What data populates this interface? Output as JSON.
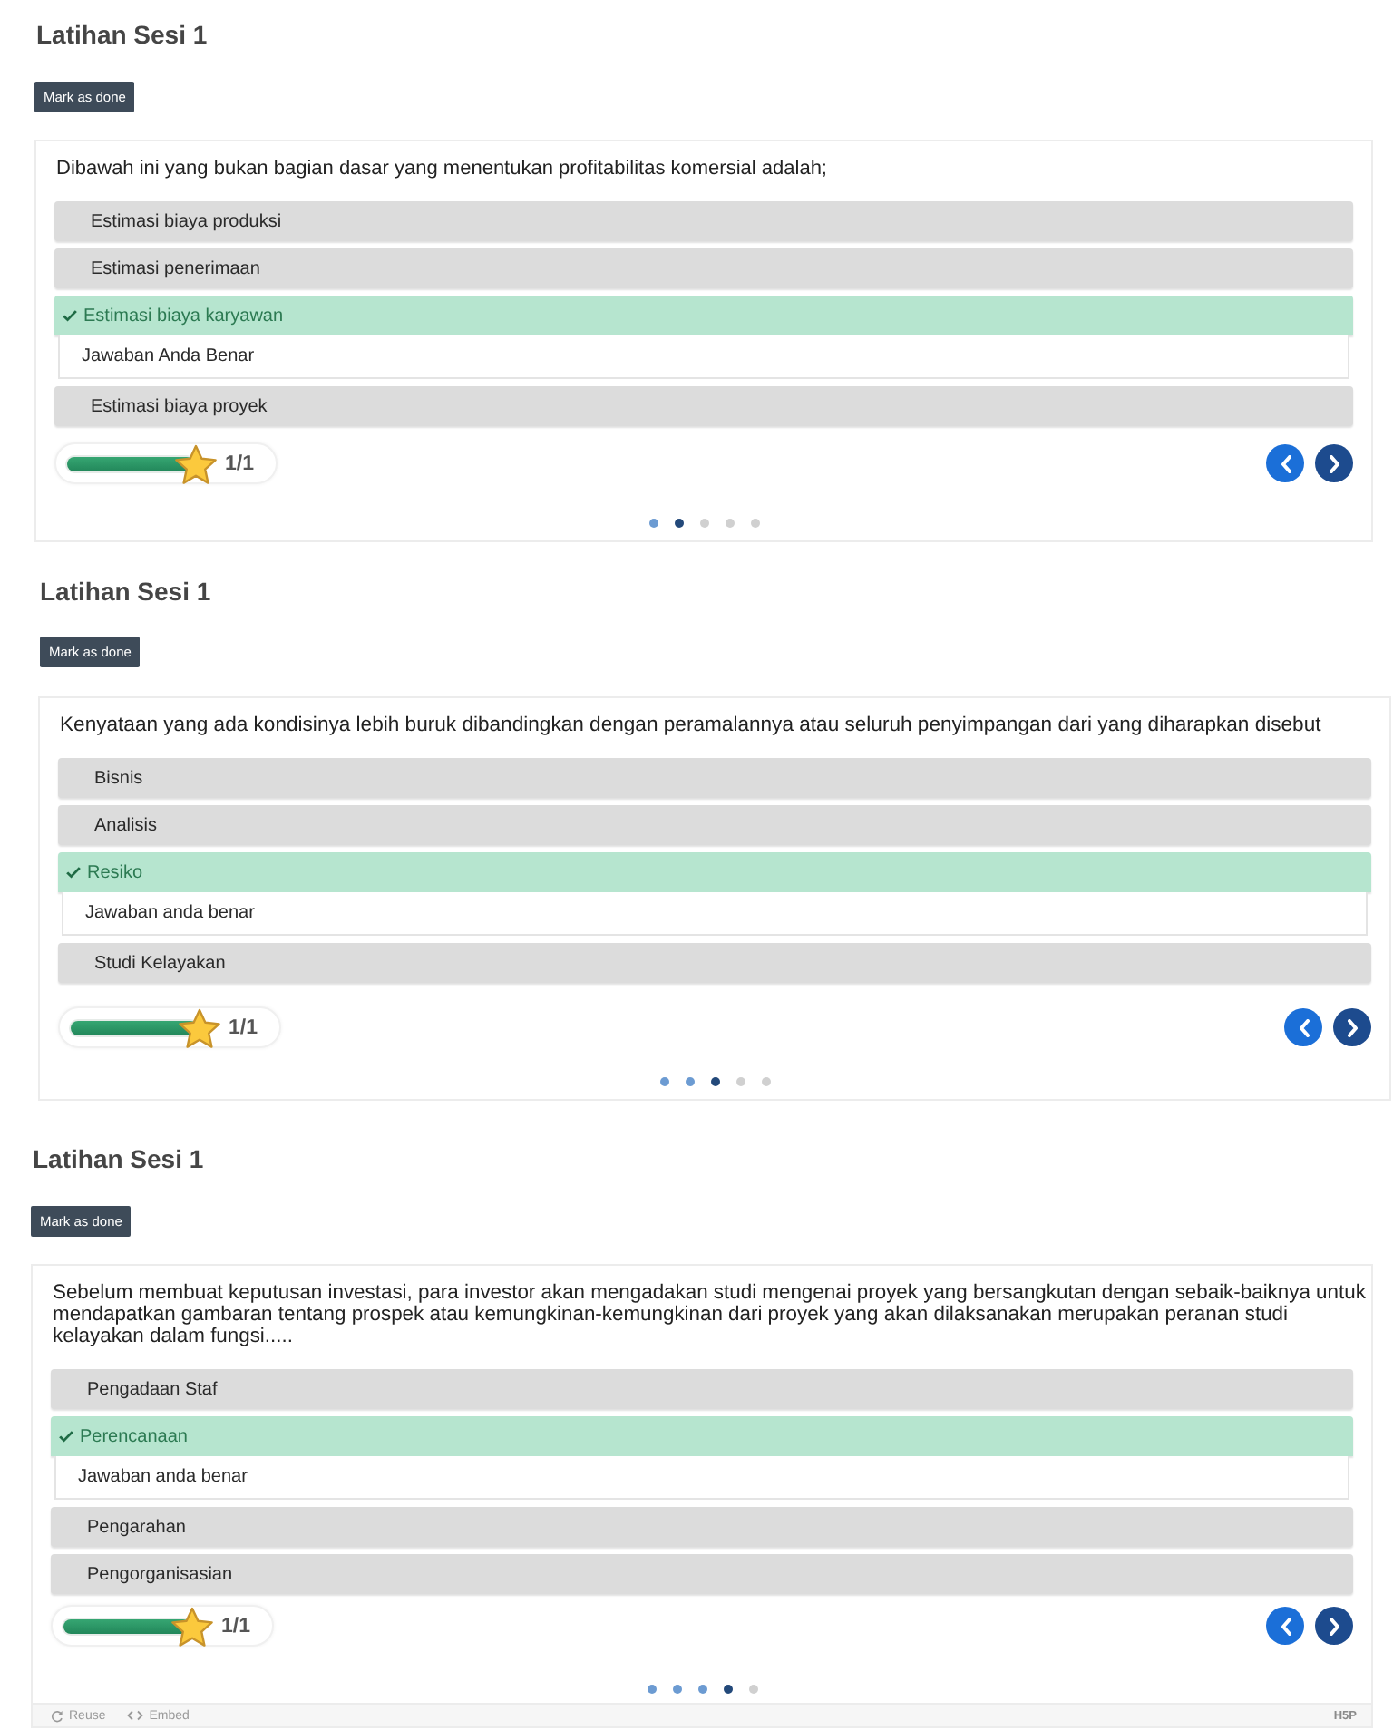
{
  "quizzes": [
    {
      "title": "Latihan Sesi 1",
      "mark_done_button": "Mark as done",
      "question": "Dibawah ini yang bukan bagian dasar yang menentukan profitabilitas komersial adalah;",
      "options": [
        {
          "text": "Estimasi biaya produksi",
          "selected": false
        },
        {
          "text": "Estimasi penerimaan",
          "selected": false
        },
        {
          "text": "Estimasi biaya karyawan",
          "selected": true,
          "feedback": "Jawaban Anda Benar"
        },
        {
          "text": "Estimasi biaya proyek",
          "selected": false
        }
      ],
      "score": {
        "level": 1,
        "reading": "1/1"
      },
      "pages": [
        {
          "selected": false,
          "answered": true
        },
        {
          "selected": true,
          "answered": true
        },
        {
          "selected": false,
          "answered": false
        },
        {
          "selected": false,
          "answered": false
        },
        {
          "selected": false,
          "answered": false
        }
      ]
    },
    {
      "title": "Latihan Sesi 1",
      "mark_done_button": "Mark as done",
      "question": "Kenyataan yang ada kondisinya lebih buruk dibandingkan dengan peramalannya atau seluruh penyimpangan dari yang diharapkan disebut",
      "options": [
        {
          "text": "Bisnis",
          "selected": false
        },
        {
          "text": "Analisis",
          "selected": false
        },
        {
          "text": "Resiko",
          "selected": true,
          "feedback": "Jawaban anda benar"
        },
        {
          "text": "Studi Kelayakan",
          "selected": false
        }
      ],
      "score": {
        "level": 1,
        "reading": "1/1"
      },
      "pages": [
        {
          "selected": false,
          "answered": true
        },
        {
          "selected": false,
          "answered": true
        },
        {
          "selected": true,
          "answered": true
        },
        {
          "selected": false,
          "answered": false
        },
        {
          "selected": false,
          "answered": false
        }
      ]
    },
    {
      "title": "Latihan Sesi 1",
      "mark_done_button": "Mark as done",
      "question": "Sebelum membuat keputusan investasi, para investor akan mengadakan studi mengenai proyek yang bersangkutan dengan sebaik-baiknya untuk mendapatkan gambaran tentang prospek atau kemungkinan-kemungkinan dari proyek yang akan dilaksanakan merupakan peranan studi kelayakan dalam fungsi.....",
      "options": [
        {
          "text": "Pengadaan Staf",
          "selected": false
        },
        {
          "text": "Perencanaan",
          "selected": true,
          "feedback": "Jawaban anda benar"
        },
        {
          "text": "Pengarahan",
          "selected": false
        },
        {
          "text": "Pengorganisasian",
          "selected": false
        }
      ],
      "score": {
        "level": 1,
        "reading": "1/1"
      },
      "pages": [
        {
          "selected": false,
          "answered": true
        },
        {
          "selected": false,
          "answered": true
        },
        {
          "selected": false,
          "answered": true
        },
        {
          "selected": true,
          "answered": true
        },
        {
          "selected": false,
          "answered": false
        }
      ]
    }
  ],
  "footer": {
    "reuse": "Reuse",
    "embed": "Embed",
    "logo": "H5P"
  }
}
